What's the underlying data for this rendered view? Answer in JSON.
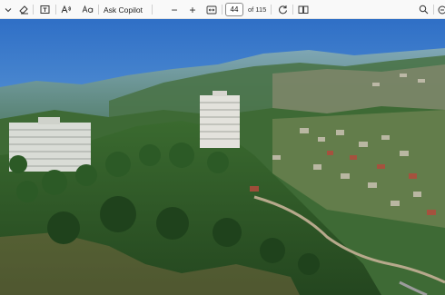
{
  "toolbar": {
    "icons": [
      "chevron-down-icon",
      "eraser-icon",
      "text-box-icon",
      "read-aloud-icon",
      "translate-icon",
      "zoom-out-icon",
      "zoom-in-icon",
      "fit-page-icon",
      "rotate-icon",
      "two-page-view-icon",
      "search-icon",
      "copilot-icon"
    ],
    "ask_label": "Ask Copilot",
    "zoom_out": "−",
    "zoom_in": "+",
    "page_current": "44",
    "page_total": "of 115"
  },
  "document": {
    "content": "aerial-photo"
  },
  "colors": {
    "toolbar_bg": "#f9f9f9",
    "sky_top": "#2f6fc6",
    "sky_horizon": "#b9d8ee",
    "forest": "#2f5d2a"
  }
}
